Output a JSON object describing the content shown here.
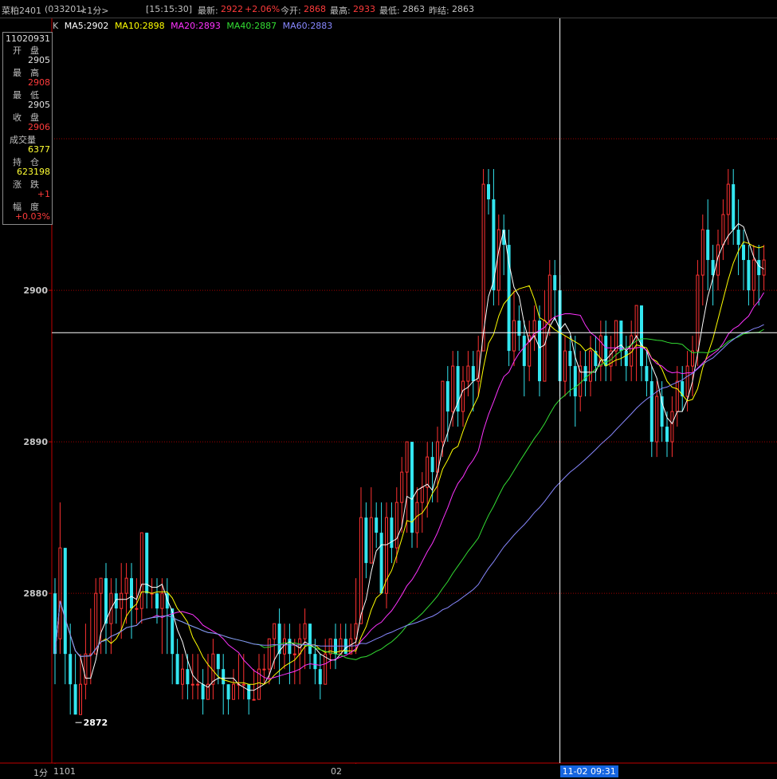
{
  "header": {
    "symbol": "菜粕2401",
    "code": "(033201)",
    "period": "<1分>",
    "time": "[15:15:30]",
    "latest_label": "最新:",
    "latest_value": "2922",
    "change_pct": "+2.06%",
    "open_label": "今开:",
    "open_value": "2868",
    "high_label": "最高:",
    "high_value": "2933",
    "low_label": "最低:",
    "low_value": "2863",
    "prev_settle_label": "昨结:",
    "prev_settle_value": "2863"
  },
  "ma_legend": {
    "k": "K",
    "items": [
      {
        "label": "MA5:2902",
        "color": "#ffffff"
      },
      {
        "label": "MA10:2898",
        "color": "#ffff00"
      },
      {
        "label": "MA20:2893",
        "color": "#ff33ff"
      },
      {
        "label": "MA40:2887",
        "color": "#33dd33"
      },
      {
        "label": "MA60:2883",
        "color": "#8888ff"
      }
    ]
  },
  "info_box": {
    "datetime": "11020931",
    "open_label": "开　盘",
    "open_value": "2905",
    "high_label": "最　高",
    "high_value": "2908",
    "low_label": "最　低",
    "low_value": "2905",
    "close_label": "收　盘",
    "close_value": "2906",
    "volume_label": "成交量",
    "volume_value": "6377",
    "oi_label": "持　仓",
    "oi_value": "623198",
    "change_label": "涨　跌",
    "change_value": "+1",
    "range_label": "幅　度",
    "range_value": "+0.03%"
  },
  "colors": {
    "up": "#ff3232",
    "down": "#33e6f0",
    "grid": "#a00000",
    "axis": "#c00000",
    "crosshair": "#ffffff"
  },
  "axis": {
    "bottom_left": "1分",
    "x_ticks": [
      "1101",
      "02"
    ],
    "cursor_time": "11-02 09:31",
    "low_marker": "2872"
  },
  "chart_data": {
    "type": "candlestick",
    "ylim": [
      2868.8,
      2918
    ],
    "yticks": [
      2880,
      2890,
      2900,
      2910
    ],
    "grid_lines": [
      2880,
      2890,
      2900,
      2910,
      2920,
      2930,
      2940,
      2950,
      2960
    ],
    "crosshair_price": 2897.2,
    "cursor_bar": 99,
    "x_tick_bars": [
      0,
      59
    ],
    "low_marker_bar": 4,
    "candles": [
      [
        2880,
        2876,
        2881,
        2874
      ],
      [
        2877,
        2883,
        2886,
        2876
      ],
      [
        2883,
        2876,
        2883,
        2874
      ],
      [
        2876,
        2874,
        2878,
        2872
      ],
      [
        2874,
        2872,
        2876,
        2872
      ],
      [
        2872,
        2874,
        2876,
        2873
      ],
      [
        2874,
        2876,
        2878,
        2873
      ],
      [
        2876,
        2876,
        2879,
        2874
      ],
      [
        2876,
        2880,
        2881,
        2876
      ],
      [
        2880,
        2881,
        2881,
        2876
      ],
      [
        2881,
        2878,
        2882,
        2876
      ],
      [
        2878,
        2880,
        2881,
        2876
      ],
      [
        2880,
        2879,
        2881,
        2878
      ],
      [
        2879,
        2880,
        2882,
        2877
      ],
      [
        2880,
        2881,
        2882,
        2878
      ],
      [
        2881,
        2879,
        2882,
        2877
      ],
      [
        2879,
        2879,
        2881,
        2878
      ],
      [
        2879,
        2884,
        2884,
        2878
      ],
      [
        2884,
        2880,
        2884,
        2879
      ],
      [
        2880,
        2880,
        2881,
        2879
      ],
      [
        2880,
        2879,
        2881,
        2878
      ],
      [
        2879,
        2880,
        2881,
        2876
      ],
      [
        2880,
        2879,
        2881,
        2876
      ],
      [
        2879,
        2876,
        2879,
        2874
      ],
      [
        2876,
        2874,
        2877,
        2874
      ],
      [
        2874,
        2875,
        2876,
        2873
      ],
      [
        2875,
        2874,
        2876,
        2873
      ],
      [
        2874,
        2874,
        2876,
        2873
      ],
      [
        2874,
        2874,
        2876,
        2873
      ],
      [
        2874,
        2873,
        2875,
        2872
      ],
      [
        2873,
        2874,
        2876,
        2873
      ],
      [
        2874,
        2876,
        2877,
        2873
      ],
      [
        2876,
        2875,
        2876,
        2874
      ],
      [
        2875,
        2874,
        2876,
        2872
      ],
      [
        2874,
        2873,
        2874,
        2872
      ],
      [
        2873,
        2874,
        2875,
        2873
      ],
      [
        2874,
        2874,
        2876,
        2873
      ],
      [
        2874,
        2874,
        2876,
        2873
      ],
      [
        2874,
        2873,
        2874,
        2872
      ],
      [
        2873,
        2873,
        2875,
        2873
      ],
      [
        2873,
        2875,
        2876,
        2873
      ],
      [
        2875,
        2875,
        2876,
        2874
      ],
      [
        2875,
        2877,
        2877,
        2874
      ],
      [
        2877,
        2878,
        2878,
        2875
      ],
      [
        2878,
        2876,
        2879,
        2874
      ],
      [
        2876,
        2877,
        2878,
        2875
      ],
      [
        2877,
        2876,
        2878,
        2874
      ],
      [
        2876,
        2876,
        2877,
        2874
      ],
      [
        2876,
        2877,
        2878,
        2874
      ],
      [
        2877,
        2878,
        2879,
        2875
      ],
      [
        2878,
        2876,
        2878,
        2875
      ],
      [
        2876,
        2875,
        2877,
        2874
      ],
      [
        2875,
        2874,
        2876,
        2873
      ],
      [
        2874,
        2876,
        2877,
        2874
      ],
      [
        2876,
        2877,
        2877,
        2875
      ],
      [
        2877,
        2876,
        2878,
        2875
      ],
      [
        2876,
        2877,
        2878,
        2876
      ],
      [
        2877,
        2876,
        2878,
        2876
      ],
      [
        2876,
        2877,
        2878,
        2876
      ],
      [
        2877,
        2878,
        2881,
        2876
      ],
      [
        2878,
        2885,
        2887,
        2878
      ],
      [
        2885,
        2882,
        2886,
        2881
      ],
      [
        2882,
        2885,
        2887,
        2882
      ],
      [
        2885,
        2884,
        2886,
        2883
      ],
      [
        2884,
        2880,
        2886,
        2880
      ],
      [
        2880,
        2885,
        2886,
        2879
      ],
      [
        2885,
        2883,
        2886,
        2882
      ],
      [
        2883,
        2886,
        2887,
        2882
      ],
      [
        2886,
        2888,
        2889,
        2884
      ],
      [
        2888,
        2890,
        2890,
        2884
      ],
      [
        2890,
        2884,
        2890,
        2883
      ],
      [
        2884,
        2886,
        2887,
        2883
      ],
      [
        2886,
        2887,
        2888,
        2884
      ],
      [
        2887,
        2889,
        2890,
        2885
      ],
      [
        2889,
        2888,
        2890,
        2886
      ],
      [
        2888,
        2890,
        2891,
        2886
      ],
      [
        2890,
        2894,
        2894,
        2889
      ],
      [
        2894,
        2892,
        2895,
        2890
      ],
      [
        2892,
        2895,
        2896,
        2891
      ],
      [
        2895,
        2892,
        2896,
        2891
      ],
      [
        2892,
        2894,
        2895,
        2891
      ],
      [
        2894,
        2895,
        2896,
        2893
      ],
      [
        2895,
        2894,
        2896,
        2892
      ],
      [
        2894,
        2896,
        2897,
        2893
      ],
      [
        2896,
        2907,
        2908,
        2896
      ],
      [
        2907,
        2906,
        2908,
        2905
      ],
      [
        2906,
        2900,
        2908,
        2899
      ],
      [
        2900,
        2904,
        2905,
        2899
      ],
      [
        2904,
        2903,
        2905,
        2901
      ],
      [
        2903,
        2896,
        2904,
        2895
      ],
      [
        2896,
        2898,
        2900,
        2895
      ],
      [
        2898,
        2897,
        2899,
        2896
      ],
      [
        2897,
        2895,
        2898,
        2893
      ],
      [
        2895,
        2897,
        2898,
        2894
      ],
      [
        2897,
        2898,
        2899,
        2896
      ],
      [
        2898,
        2894,
        2899,
        2893
      ],
      [
        2894,
        2898,
        2900,
        2894
      ],
      [
        2898,
        2901,
        2902,
        2897
      ],
      [
        2901,
        2900,
        2902,
        2898
      ],
      [
        2900,
        2894,
        2901,
        2893
      ],
      [
        2894,
        2896,
        2897,
        2893
      ],
      [
        2896,
        2895,
        2897,
        2893
      ],
      [
        2895,
        2893,
        2897,
        2891
      ],
      [
        2893,
        2895,
        2896,
        2892
      ],
      [
        2895,
        2894,
        2896,
        2893
      ],
      [
        2894,
        2896,
        2897,
        2893
      ],
      [
        2896,
        2895,
        2897,
        2894
      ],
      [
        2895,
        2897,
        2898,
        2894
      ],
      [
        2897,
        2895,
        2898,
        2894
      ],
      [
        2895,
        2896,
        2897,
        2894
      ],
      [
        2896,
        2898,
        2898,
        2895
      ],
      [
        2898,
        2896,
        2898,
        2895
      ],
      [
        2896,
        2895,
        2897,
        2894
      ],
      [
        2895,
        2897,
        2898,
        2894
      ],
      [
        2897,
        2899,
        2899,
        2894
      ],
      [
        2899,
        2895,
        2899,
        2894
      ],
      [
        2895,
        2894,
        2896,
        2893
      ],
      [
        2894,
        2890,
        2895,
        2889
      ],
      [
        2890,
        2893,
        2894,
        2889
      ],
      [
        2893,
        2891,
        2894,
        2890
      ],
      [
        2891,
        2890,
        2892,
        2889
      ],
      [
        2890,
        2892,
        2893,
        2889
      ],
      [
        2892,
        2894,
        2895,
        2891
      ],
      [
        2894,
        2893,
        2895,
        2892
      ],
      [
        2893,
        2895,
        2896,
        2892
      ],
      [
        2895,
        2896,
        2897,
        2893
      ],
      [
        2896,
        2901,
        2902,
        2895
      ],
      [
        2901,
        2904,
        2905,
        2899
      ],
      [
        2904,
        2902,
        2906,
        2900
      ],
      [
        2902,
        2901,
        2903,
        2899
      ],
      [
        2901,
        2903,
        2904,
        2900
      ],
      [
        2903,
        2905,
        2906,
        2902
      ],
      [
        2905,
        2907,
        2908,
        2903
      ],
      [
        2907,
        2904,
        2908,
        2903
      ],
      [
        2904,
        2903,
        2906,
        2901
      ],
      [
        2903,
        2902,
        2904,
        2900
      ],
      [
        2902,
        2900,
        2903,
        2899
      ],
      [
        2900,
        2902,
        2903,
        2899
      ],
      [
        2902,
        2901,
        2903,
        2899
      ],
      [
        2901,
        2902,
        2903,
        2900
      ]
    ]
  }
}
